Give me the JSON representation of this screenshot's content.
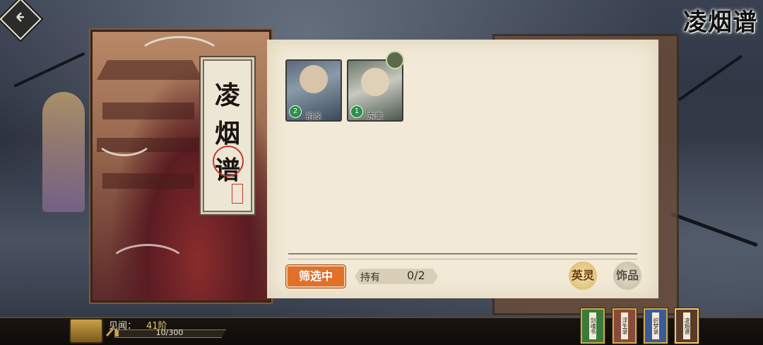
{
  "game": {
    "top_title": "凌烟谱",
    "book_title_chars": [
      "凌",
      "烟",
      "谱"
    ]
  },
  "cards": [
    {
      "name": "祖龙",
      "badge": "2"
    },
    {
      "name": "东离",
      "badge": "1"
    }
  ],
  "filter": {
    "label": "筛选中"
  },
  "owned": {
    "label": "持有",
    "count": "0/2"
  },
  "side_buttons": {
    "seal": "英灵",
    "ornament": "饰品"
  },
  "status": {
    "level_label": "见闻：",
    "level_value": "41阶",
    "exp_text": "10/300",
    "exp_progress": 0.033
  },
  "book_tabs": [
    {
      "label": "剑魂书",
      "color": "#3a7a3a"
    },
    {
      "label": "浮生录",
      "color": "#8a4a3a"
    },
    {
      "label": "织梦录",
      "color": "#3a5a9a"
    },
    {
      "label": "凌烟谱",
      "color": "#5a3a2a"
    }
  ],
  "colors": {
    "accent": "#e0702a",
    "badge": "#2f8f4e",
    "paper": "#f2ead7"
  }
}
